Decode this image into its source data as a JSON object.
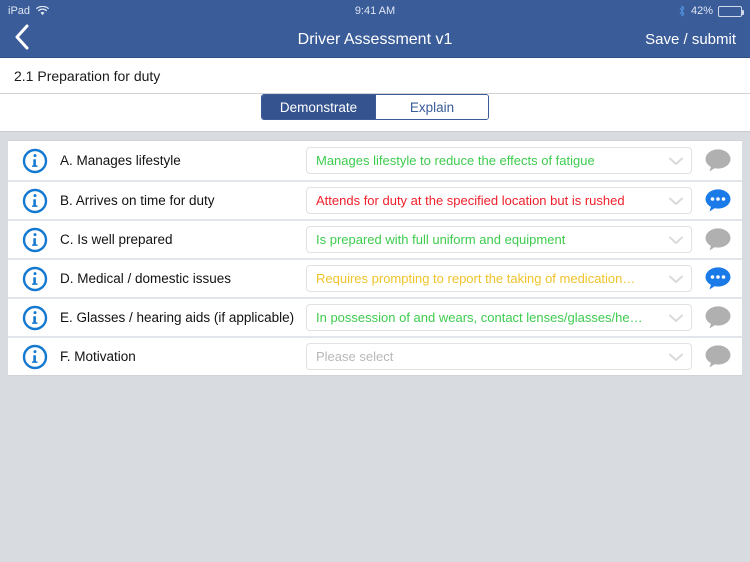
{
  "status_bar": {
    "device_label": "iPad",
    "wifi_icon": "wifi-icon",
    "time": "9:41 AM",
    "bluetooth_icon": "bluetooth-icon",
    "battery_percent": "42%",
    "battery_level": 42
  },
  "nav_bar": {
    "back_icon": "chevron-left-icon",
    "title": "Driver Assessment v1",
    "action_label": "Save / submit"
  },
  "section": {
    "title": "2.1 Preparation for duty"
  },
  "tabs": [
    {
      "label": "Demonstrate",
      "active": true
    },
    {
      "label": "Explain",
      "active": false
    }
  ],
  "colors": {
    "nav_blue": "#3a5c99",
    "segment_active": "#34538f",
    "green": "#3ecc4f",
    "red": "#f0202a",
    "amber": "#f0c32c",
    "placeholder_grey": "#b8b8b8",
    "bubble_grey": "#b0b0b0",
    "bubble_blue": "#1a7ae8",
    "info_blue": "#1479d1",
    "page_bg": "#d8dce0"
  },
  "select_placeholder": "Please select",
  "rows": [
    {
      "info_icon": "info-circle-icon",
      "label": "A. Manages lifestyle",
      "value": "Manages lifestyle to reduce the effects of fatigue",
      "value_state": "green",
      "comment_icon": "comment-bubble-icon",
      "comment_active": false
    },
    {
      "info_icon": "info-circle-icon",
      "label": "B. Arrives on time for duty",
      "value": "Attends for duty at the specified location but is rushed",
      "value_state": "red",
      "comment_icon": "comment-bubble-icon",
      "comment_active": true
    },
    {
      "info_icon": "info-circle-icon",
      "label": "C. Is well prepared",
      "value": "Is prepared with full uniform and equipment",
      "value_state": "green",
      "comment_icon": "comment-bubble-icon",
      "comment_active": false
    },
    {
      "info_icon": "info-circle-icon",
      "label": "D. Medical / domestic issues",
      "value": "Requires prompting to report the taking of medication…",
      "value_state": "amber",
      "comment_icon": "comment-bubble-icon",
      "comment_active": true
    },
    {
      "info_icon": "info-circle-icon",
      "label": "E. Glasses / hearing aids (if applicable)",
      "value": "In possession of and wears, contact lenses/glasses/he…",
      "value_state": "green",
      "comment_icon": "comment-bubble-icon",
      "comment_active": false
    },
    {
      "info_icon": "info-circle-icon",
      "label": "F. Motivation",
      "value": "",
      "value_state": "placeholder",
      "comment_icon": "comment-bubble-icon",
      "comment_active": false
    }
  ]
}
